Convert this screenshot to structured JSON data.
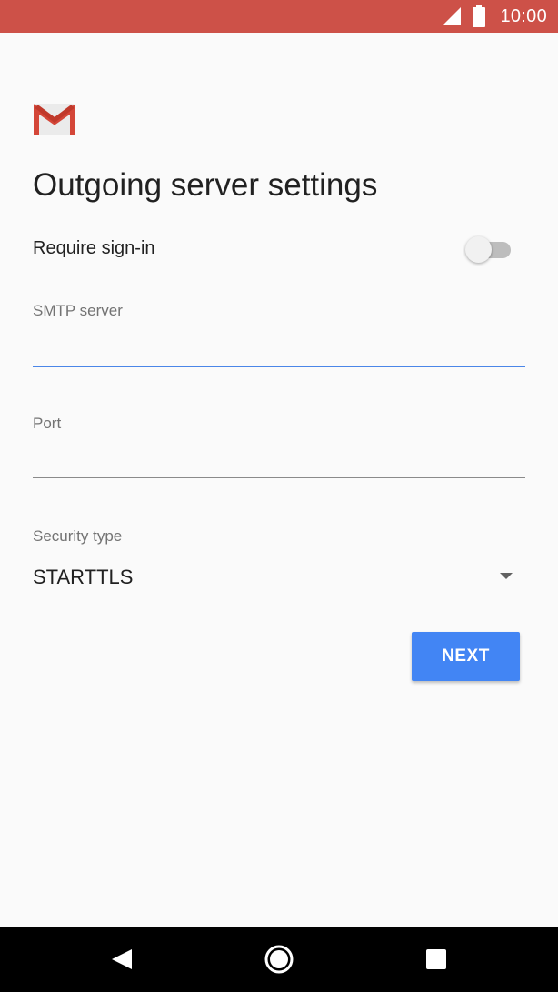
{
  "status_bar": {
    "time": "10:00",
    "color": "#cd5148",
    "icons": [
      "signal-icon",
      "battery-icon"
    ]
  },
  "app": {
    "logo": "gmail-logo-icon"
  },
  "page": {
    "title": "Outgoing server settings"
  },
  "require_signin": {
    "label": "Require sign-in",
    "enabled": false
  },
  "smtp_server": {
    "label": "SMTP server",
    "value": "",
    "focused": true
  },
  "port": {
    "label": "Port",
    "value": ""
  },
  "security_type": {
    "label": "Security type",
    "selected": "STARTTLS"
  },
  "actions": {
    "next_label": "NEXT",
    "accent": "#4285f4"
  },
  "nav_bar": {
    "icons": [
      "back-icon",
      "home-icon",
      "recents-icon"
    ]
  }
}
